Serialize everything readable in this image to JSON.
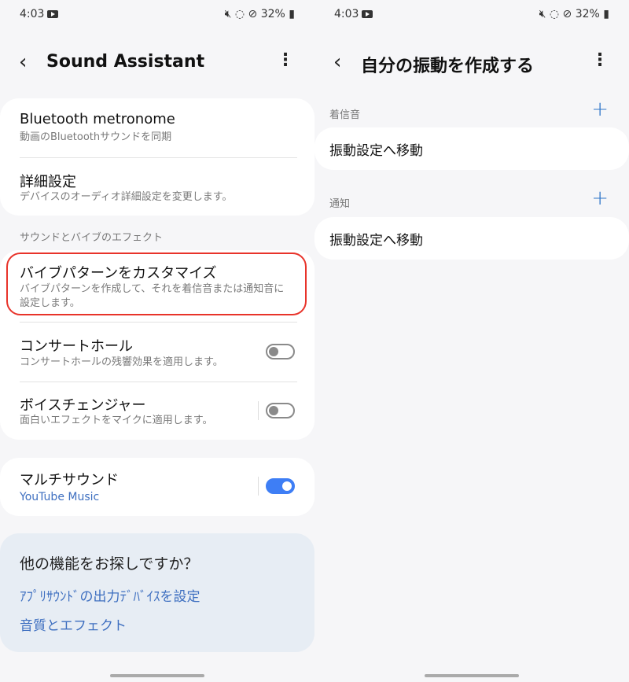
{
  "status": {
    "time": "4:03",
    "battery": "32%"
  },
  "left": {
    "title": "Sound Assistant",
    "items": [
      {
        "title": "Bluetooth metronome",
        "sub": "動画のBluetoothサウンドを同期"
      },
      {
        "title": "詳細設定",
        "sub": "デバイスのオーディオ詳細設定を変更します。"
      }
    ],
    "section": "サウンドとバイブのエフェクト",
    "effects": [
      {
        "title": "バイブパターンをカスタマイズ",
        "sub": "バイブパターンを作成して、それを着信音または通知音に設定します。"
      },
      {
        "title": "コンサートホール",
        "sub": "コンサートホールの残響効果を適用します。",
        "toggle": false
      },
      {
        "title": "ボイスチェンジャー",
        "sub": "面白いエフェクトをマイクに適用します。",
        "toggle": false
      }
    ],
    "multi": {
      "title": "マルチサウンド",
      "sub": "YouTube Music",
      "toggle": true
    },
    "suggest": {
      "title": "他の機能をお探しですか？",
      "links": [
        "ｱﾌﾟﾘｻｳﾝﾄﾞの出力ﾃﾞﾊﾞｲｽを設定",
        "音質とエフェクト"
      ]
    },
    "highlight_color": "#e8332a"
  },
  "right": {
    "title": "自分の振動を作成する",
    "sections": [
      {
        "label": "着信音",
        "item": "振動設定へ移動"
      },
      {
        "label": "通知",
        "item": "振動設定へ移動"
      }
    ]
  }
}
